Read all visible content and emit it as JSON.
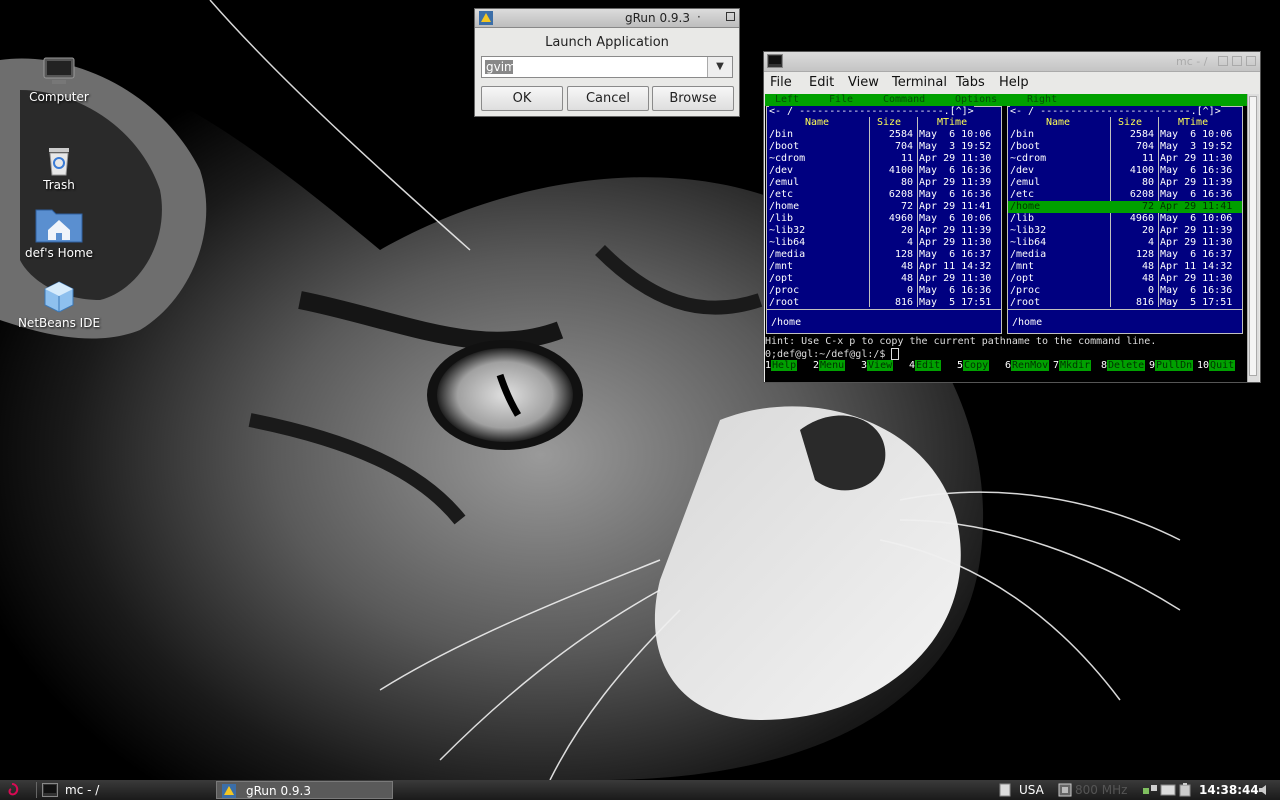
{
  "desktop": {
    "icons": [
      {
        "label": "Computer",
        "icon": "monitor-icon"
      },
      {
        "label": "Trash",
        "icon": "trash-icon"
      },
      {
        "label": "def's Home",
        "icon": "home-folder-icon"
      },
      {
        "label": "NetBeans IDE",
        "icon": "netbeans-cube-icon"
      }
    ]
  },
  "grun": {
    "title": "gRun 0.9.3",
    "title_dot": "·",
    "heading": "Launch Application",
    "input_value": "gvim",
    "buttons": {
      "ok": "OK",
      "cancel": "Cancel",
      "browse": "Browse"
    }
  },
  "terminal": {
    "title": "mc - /",
    "menu": [
      "File",
      "Edit",
      "View",
      "Terminal",
      "Tabs",
      "Help"
    ],
    "mc_top": [
      "Left",
      "File",
      "Command",
      "Options",
      "Right"
    ],
    "left_panel": {
      "path": "<- / ------------------------.[^]>",
      "headers": {
        "name": "Name",
        "size": "Size",
        "mtime": "MTime"
      },
      "rows": [
        {
          "name": "/bin",
          "size": "2584",
          "mtime": "May  6 10:06"
        },
        {
          "name": "/boot",
          "size": "704",
          "mtime": "May  3 19:52"
        },
        {
          "name": "~cdrom",
          "size": "11",
          "mtime": "Apr 29 11:30"
        },
        {
          "name": "/dev",
          "size": "4100",
          "mtime": "May  6 16:36"
        },
        {
          "name": "/emul",
          "size": "80",
          "mtime": "Apr 29 11:39"
        },
        {
          "name": "/etc",
          "size": "6208",
          "mtime": "May  6 16:36"
        },
        {
          "name": "/home",
          "size": "72",
          "mtime": "Apr 29 11:41"
        },
        {
          "name": "/lib",
          "size": "4960",
          "mtime": "May  6 10:06"
        },
        {
          "name": "~lib32",
          "size": "20",
          "mtime": "Apr 29 11:39"
        },
        {
          "name": "~lib64",
          "size": "4",
          "mtime": "Apr 29 11:30"
        },
        {
          "name": "/media",
          "size": "128",
          "mtime": "May  6 16:37"
        },
        {
          "name": "/mnt",
          "size": "48",
          "mtime": "Apr 11 14:32"
        },
        {
          "name": "/opt",
          "size": "48",
          "mtime": "Apr 29 11:30"
        },
        {
          "name": "/proc",
          "size": "0",
          "mtime": "May  6 16:36"
        },
        {
          "name": "/root",
          "size": "816",
          "mtime": "May  5 17:51"
        }
      ],
      "footer": "/home"
    },
    "right_panel": {
      "path": "<- / -------------------------.[^]>",
      "headers": {
        "name": "Name",
        "size": "Size",
        "mtime": "MTime"
      },
      "rows": [
        {
          "name": "/bin",
          "size": "2584",
          "mtime": "May  6 10:06"
        },
        {
          "name": "/boot",
          "size": "704",
          "mtime": "May  3 19:52"
        },
        {
          "name": "~cdrom",
          "size": "11",
          "mtime": "Apr 29 11:30"
        },
        {
          "name": "/dev",
          "size": "4100",
          "mtime": "May  6 16:36"
        },
        {
          "name": "/emul",
          "size": "80",
          "mtime": "Apr 29 11:39"
        },
        {
          "name": "/etc",
          "size": "6208",
          "mtime": "May  6 16:36"
        },
        {
          "name": "/home",
          "size": "72",
          "mtime": "Apr 29 11:41"
        },
        {
          "name": "/lib",
          "size": "4960",
          "mtime": "May  6 10:06"
        },
        {
          "name": "~lib32",
          "size": "20",
          "mtime": "Apr 29 11:39"
        },
        {
          "name": "~lib64",
          "size": "4",
          "mtime": "Apr 29 11:30"
        },
        {
          "name": "/media",
          "size": "128",
          "mtime": "May  6 16:37"
        },
        {
          "name": "/mnt",
          "size": "48",
          "mtime": "Apr 11 14:32"
        },
        {
          "name": "/opt",
          "size": "48",
          "mtime": "Apr 29 11:30"
        },
        {
          "name": "/proc",
          "size": "0",
          "mtime": "May  6 16:36"
        },
        {
          "name": "/root",
          "size": "816",
          "mtime": "May  5 17:51"
        }
      ],
      "selected_row": 6,
      "footer": "/home"
    },
    "hint": "Hint: Use C-x p to copy the current pathname to the command line.",
    "prompt": "0;def@gl:~/def@gl:/$ ",
    "fkeys": [
      {
        "num": "1",
        "label": "Help"
      },
      {
        "num": "2",
        "label": "Menu"
      },
      {
        "num": "3",
        "label": "View"
      },
      {
        "num": "4",
        "label": "Edit"
      },
      {
        "num": "5",
        "label": "Copy"
      },
      {
        "num": "6",
        "label": "RenMov"
      },
      {
        "num": "7",
        "label": "Mkdir"
      },
      {
        "num": "8",
        "label": "Delete"
      },
      {
        "num": "9",
        "label": "PullDn"
      },
      {
        "num": "10",
        "label": "Quit"
      }
    ]
  },
  "taskbar": {
    "tasks": [
      {
        "label": "mc - /",
        "active": false
      },
      {
        "label": "gRun 0.9.3",
        "active": true
      }
    ],
    "keyboard_layout": "USA",
    "cpu_freq": "800 MHz",
    "clock": "14:38:44"
  }
}
